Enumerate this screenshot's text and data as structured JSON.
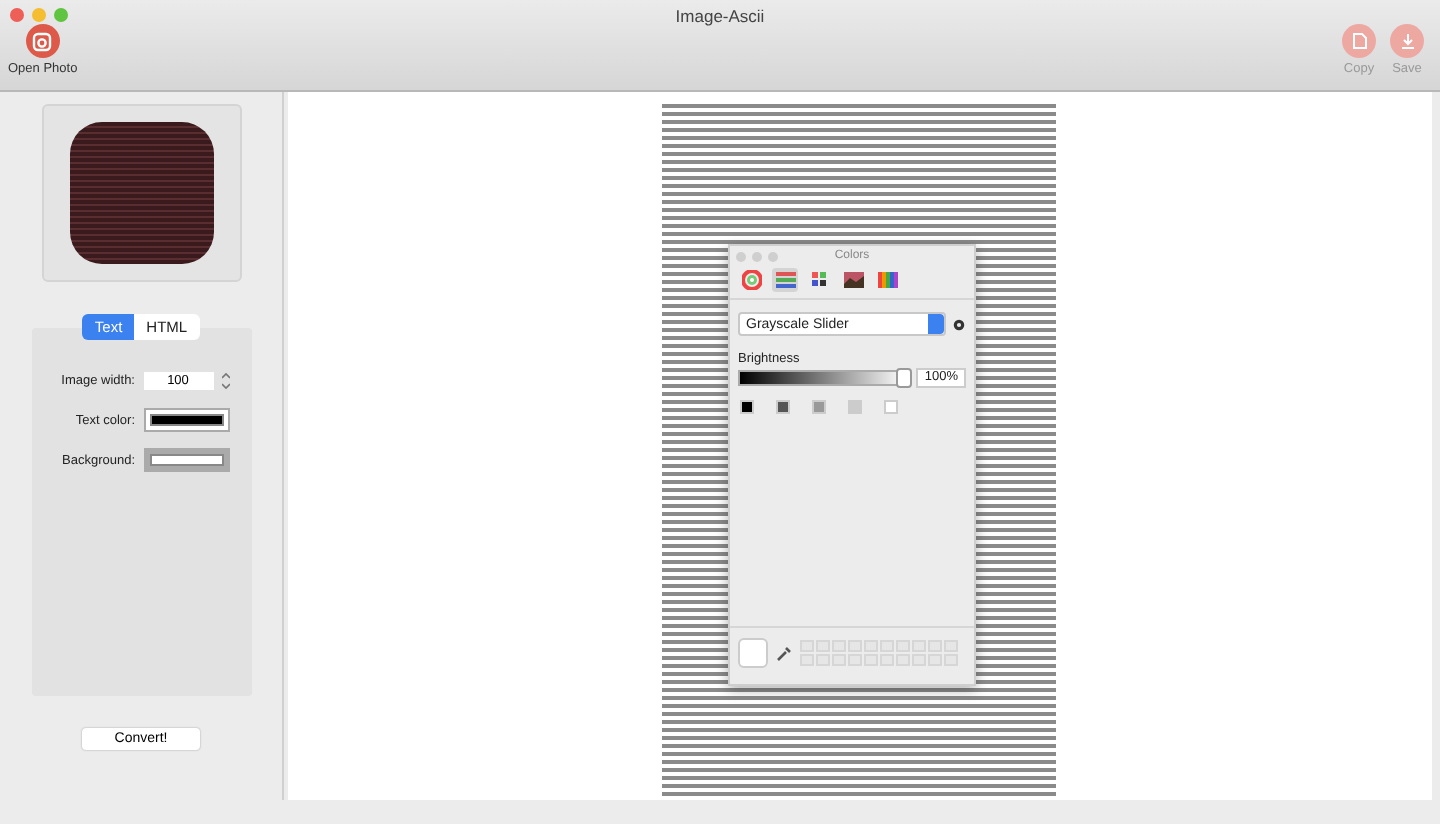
{
  "window": {
    "title": "Image-Ascii"
  },
  "toolbar": [
    {
      "label": "Open Photo",
      "disabled": false,
      "kind": "open"
    },
    {
      "label": "Copy",
      "disabled": true,
      "kind": "copy"
    },
    {
      "label": "Save",
      "disabled": true,
      "kind": "save"
    }
  ],
  "sidebar": {
    "tabs": [
      {
        "label": "Text",
        "selected": true
      },
      {
        "label": "HTML",
        "selected": false
      }
    ],
    "image_width": {
      "label": "Image width:",
      "value": "100"
    },
    "text_color": {
      "label": "Text color:",
      "color": "#000000"
    },
    "background": {
      "label": "Background:",
      "color": "#ffffff"
    },
    "convert_button": "Convert!"
  },
  "colors_panel": {
    "title": "Colors",
    "modes": [
      {
        "kind": "wheel",
        "selected": false
      },
      {
        "kind": "sliders",
        "selected": true
      },
      {
        "kind": "palettes",
        "selected": false
      },
      {
        "kind": "image",
        "selected": false
      },
      {
        "kind": "pencils",
        "selected": false
      }
    ],
    "dropdown": "Grayscale Slider",
    "slider": {
      "label": "Brightness",
      "level": 1,
      "reading": "100%"
    },
    "swatches": [
      {
        "color": "#000000"
      },
      {
        "color": "#555555"
      },
      {
        "color": "#999999"
      },
      {
        "color": "#cccccc"
      },
      {
        "color": "#ffffff"
      }
    ]
  }
}
